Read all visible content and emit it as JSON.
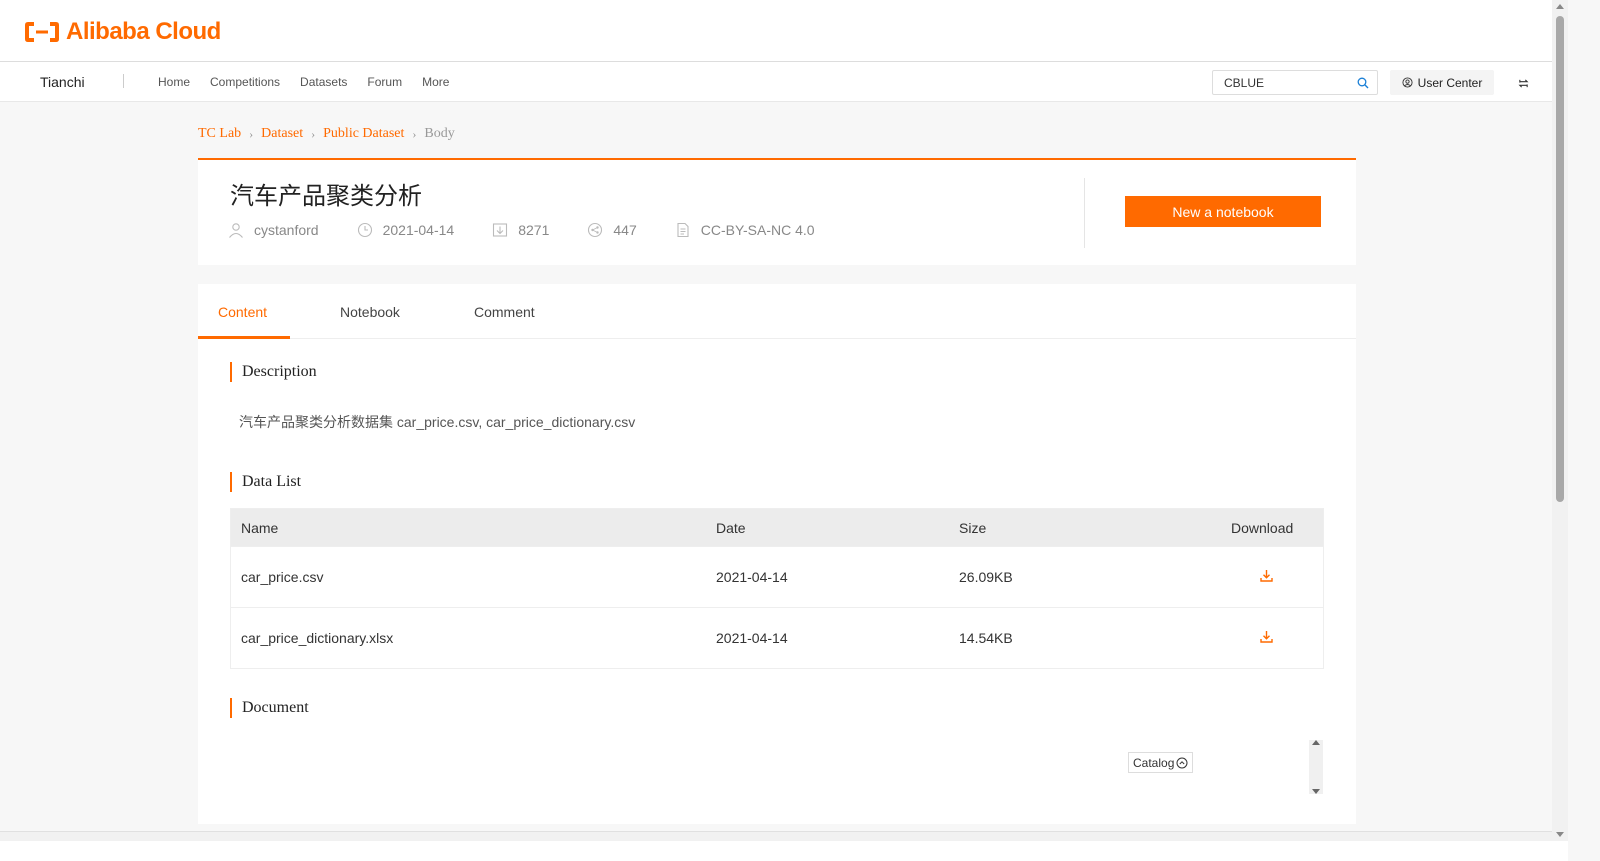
{
  "brand": {
    "logo_text": "Alibaba Cloud",
    "accent": "#ff6a00"
  },
  "nav": {
    "brand": "Tianchi",
    "links": [
      "Home",
      "Competitions",
      "Datasets",
      "Forum",
      "More"
    ],
    "search_value": "CBLUE",
    "user_center": "User Center"
  },
  "breadcrumb": [
    "TC Lab",
    "Dataset",
    "Public Dataset",
    "Body"
  ],
  "header": {
    "title": "汽车产品聚类分析",
    "author": "cystanford",
    "date": "2021-04-14",
    "downloads": "8271",
    "citations": "447",
    "license": "CC-BY-SA-NC 4.0",
    "new_notebook": "New a notebook"
  },
  "tabs": [
    "Content",
    "Notebook",
    "Comment"
  ],
  "sections": {
    "description_title": "Description",
    "description_text": "汽车产品聚类分析数据集 car_price.csv, car_price_dictionary.csv",
    "data_list_title": "Data List",
    "document_title": "Document"
  },
  "table": {
    "headers": [
      "Name",
      "Date",
      "Size",
      "Download"
    ],
    "rows": [
      {
        "name": "car_price.csv",
        "date": "2021-04-14",
        "size": "26.09KB"
      },
      {
        "name": "car_price_dictionary.xlsx",
        "date": "2021-04-14",
        "size": "14.54KB"
      }
    ]
  },
  "catalog_label": "Catalog"
}
